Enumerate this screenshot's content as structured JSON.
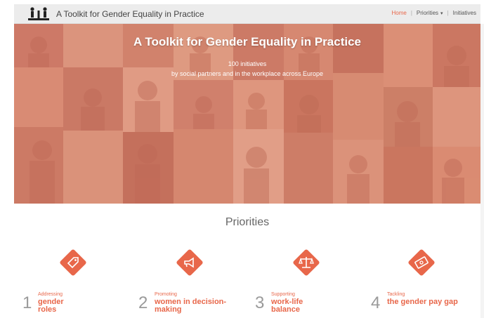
{
  "navbar": {
    "brand": "A Toolkit for Gender Equality in Practice",
    "links": {
      "home": "Home",
      "sep1": "|",
      "priorities": "Priorities",
      "priorities_caret": "▾",
      "sep2": "|",
      "initiatives": "Initiatives"
    }
  },
  "hero": {
    "title": "A Toolkit for Gender Equality in Practice",
    "count": "100 initiatives",
    "subtitle": "by social partners and in the workplace across Europe"
  },
  "priorities": {
    "title": "Priorities",
    "items": [
      {
        "number": "1",
        "verb": "Addressing",
        "label_line1": "gender",
        "label_line2": "roles",
        "icon": "tag-icon"
      },
      {
        "number": "2",
        "verb": "Promoting",
        "label_line1": "women in decision-",
        "label_line2": "making",
        "icon": "megaphone-icon"
      },
      {
        "number": "3",
        "verb": "Supporting",
        "label_line1": "work-life",
        "label_line2": "balance",
        "icon": "scales-icon"
      },
      {
        "number": "4",
        "verb": "Tackling",
        "label_line1": "the gender pay gap",
        "label_line2": "",
        "icon": "money-icon"
      }
    ]
  },
  "colors": {
    "accent": "#e8674a",
    "hero_tint": "#d98a72",
    "navbar_bg": "#ececec"
  }
}
